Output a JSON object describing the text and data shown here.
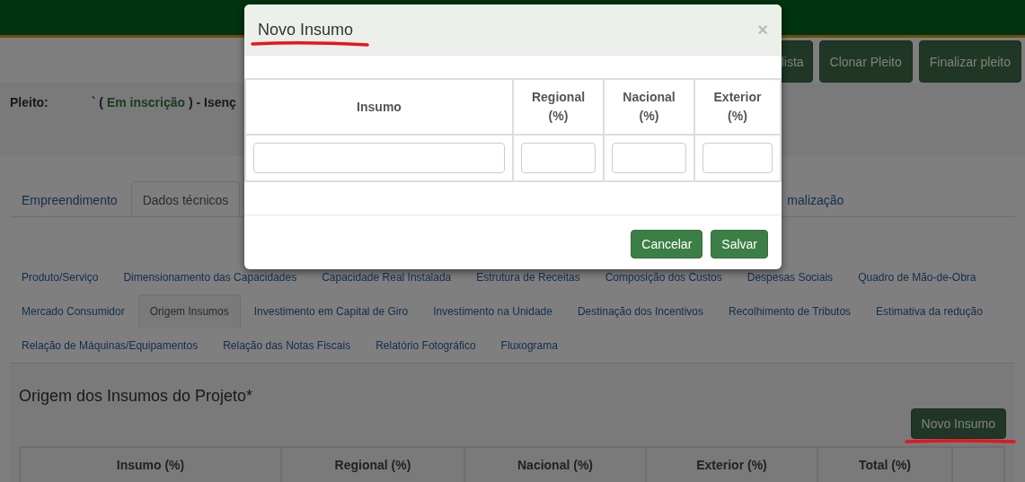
{
  "header": {
    "buttons": [
      {
        "label": "lista"
      },
      {
        "label": "Clonar Pleito"
      },
      {
        "label": "Finalizar pleito"
      }
    ]
  },
  "pleito": {
    "label": "Pleito:",
    "prefix": "` (",
    "status": "Em inscrição",
    "suffix": ") - Isenç"
  },
  "tabs": [
    {
      "label": "Empreendimento",
      "selected": false
    },
    {
      "label": "Dados técnicos",
      "selected": true
    },
    {
      "label": "malização",
      "selected": false
    }
  ],
  "subtab_rows": [
    [
      {
        "label": "Produto/Serviço",
        "selected": false
      },
      {
        "label": "Dimensionamento das Capacidades",
        "selected": false
      },
      {
        "label": "Capacidade Real Instalada",
        "selected": false
      },
      {
        "label": "Estrutura de Receitas",
        "selected": false
      },
      {
        "label": "Composição dos Custos",
        "selected": false
      },
      {
        "label": "Despesas Sociais",
        "selected": false
      },
      {
        "label": "Quadro de Mão-de-Obra",
        "selected": false
      }
    ],
    [
      {
        "label": "Mercado Consumidor",
        "selected": false
      },
      {
        "label": "Origem Insumos",
        "selected": true
      },
      {
        "label": "Investimento em Capital de Giro",
        "selected": false
      },
      {
        "label": "Investimento na Unidade",
        "selected": false
      },
      {
        "label": "Destinação dos Incentivos",
        "selected": false
      },
      {
        "label": "Recolhimento de Tributos",
        "selected": false
      },
      {
        "label": "Estimativa da redução",
        "selected": false
      }
    ],
    [
      {
        "label": "Relação de Máquinas/Equipamentos",
        "selected": false
      },
      {
        "label": "Relação das Notas Fiscais",
        "selected": false
      },
      {
        "label": "Relatório Fotográfico",
        "selected": false
      },
      {
        "label": "Fluxograma",
        "selected": false
      }
    ]
  ],
  "section": {
    "title": "Origem dos Insumos do Projeto*",
    "button": "Novo Insumo",
    "columns": [
      "Insumo (%)",
      "Regional (%)",
      "Nacional (%)",
      "Exterior (%)",
      "Total (%)"
    ]
  },
  "modal": {
    "title": "Novo Insumo",
    "close": "×",
    "columns": [
      "Insumo",
      "Regional (%)",
      "Nacional (%)",
      "Exterior (%)"
    ],
    "buttons": [
      "Cancelar",
      "Salvar"
    ]
  }
}
